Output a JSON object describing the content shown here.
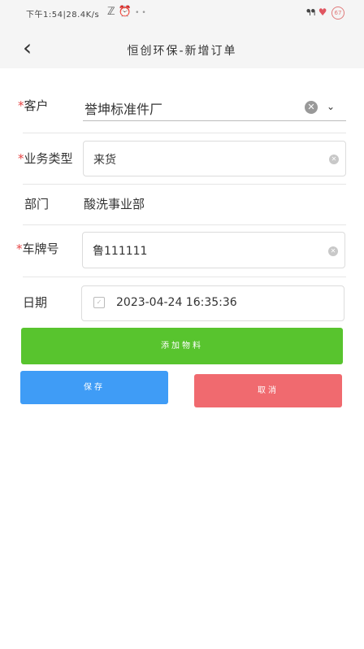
{
  "status_bar": {
    "time": "下午1:54",
    "speed": "28.4K/s",
    "right_text": "ᘏ",
    "battery": "67"
  },
  "nav": {
    "back_icon": "chevron-left-icon",
    "title": "恒创环保-新增订单"
  },
  "form": {
    "customer": {
      "required": "*",
      "label": "客户",
      "value": "誉坤标准件厂"
    },
    "business_type": {
      "required": "*",
      "label": "业务类型",
      "value": "来货"
    },
    "department": {
      "label": "部门",
      "value": "酸洗事业部"
    },
    "plate": {
      "required": "*",
      "label": "车牌号",
      "value": "鲁111111"
    },
    "date": {
      "label": "日期",
      "value": "2023-04-24 16:35:36"
    }
  },
  "buttons": {
    "add_material": "添加物料",
    "save": "保存",
    "cancel": "取消"
  },
  "colors": {
    "green": "#58c42e",
    "blue": "#3f9cf6",
    "red": "#f06a6f",
    "required": "#e64545"
  }
}
